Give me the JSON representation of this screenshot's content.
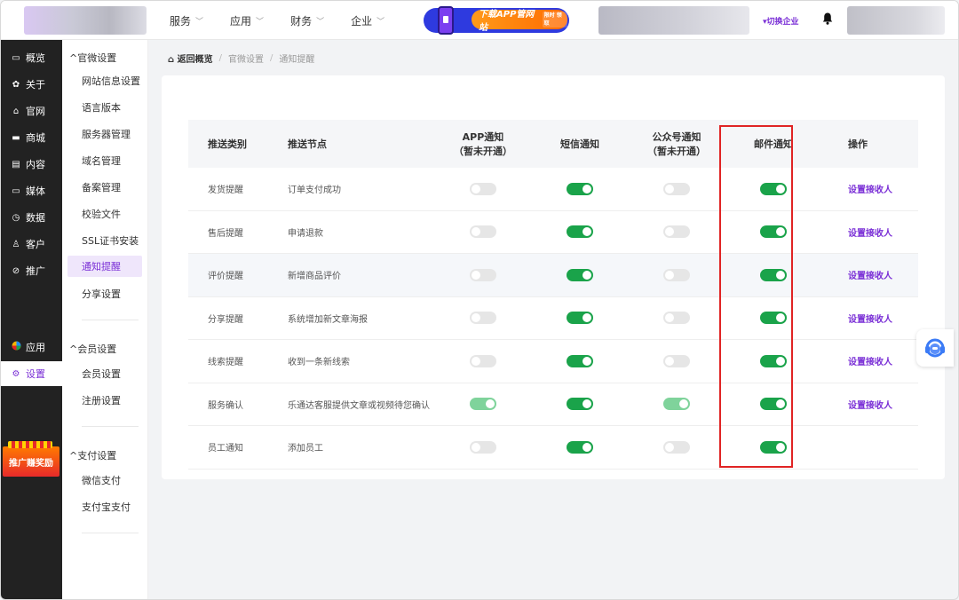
{
  "topnav": {
    "items": [
      {
        "label": "服务"
      },
      {
        "label": "应用"
      },
      {
        "label": "财务"
      },
      {
        "label": "企业"
      }
    ],
    "download_banner": "下载APP管网站",
    "banner_tag": "限时 领取",
    "switch_enterprise": "▾切换企业"
  },
  "sidebar_main": {
    "items": [
      {
        "label": "概览",
        "icon": "overview-icon"
      },
      {
        "label": "关于",
        "icon": "gear-icon"
      },
      {
        "label": "官网",
        "icon": "home-icon"
      },
      {
        "label": "商城",
        "icon": "shop-icon"
      },
      {
        "label": "内容",
        "icon": "document-icon"
      },
      {
        "label": "媒体",
        "icon": "media-icon"
      },
      {
        "label": "数据",
        "icon": "clock-icon"
      },
      {
        "label": "客户",
        "icon": "user-icon"
      },
      {
        "label": "推广",
        "icon": "link-icon"
      },
      {
        "label": "应用",
        "icon": "apps-icon"
      },
      {
        "label": "设置",
        "icon": "settings-icon"
      }
    ],
    "promo": "推广赚奖励"
  },
  "sidebar_sub": {
    "group1": "官微设置",
    "group1_items": [
      "网站信息设置",
      "语言版本",
      "服务器管理",
      "域名管理",
      "备案管理",
      "校验文件",
      "SSL证书安装",
      "通知提醒",
      "分享设置"
    ],
    "group2": "会员设置",
    "group2_items": [
      "会员设置",
      "注册设置"
    ],
    "group3": "支付设置",
    "group3_items": [
      "微信支付",
      "支付宝支付"
    ]
  },
  "breadcrumb": {
    "home": "返回概览",
    "level1": "官微设置",
    "level2": "通知提醒"
  },
  "table": {
    "headers": {
      "type": "推送类别",
      "node": "推送节点",
      "app": "APP通知",
      "app_note": "（暂未开通）",
      "sms": "短信通知",
      "wechat": "公众号通知",
      "wechat_note": "（暂未开通）",
      "email": "邮件通知",
      "action": "操作"
    },
    "rows": [
      {
        "type": "发货提醒",
        "node": "订单支付成功",
        "app": "off",
        "sms": "on",
        "wechat": "off",
        "email": "on",
        "action": "设置接收人"
      },
      {
        "type": "售后提醒",
        "node": "申请退款",
        "app": "off",
        "sms": "on",
        "wechat": "off",
        "email": "on",
        "action": "设置接收人"
      },
      {
        "type": "评价提醒",
        "node": "新增商品评价",
        "app": "off",
        "sms": "on",
        "wechat": "off",
        "email": "on",
        "action": "设置接收人"
      },
      {
        "type": "分享提醒",
        "node": "系统增加新文章海报",
        "app": "off",
        "sms": "on",
        "wechat": "off",
        "email": "on",
        "action": "设置接收人"
      },
      {
        "type": "线索提醒",
        "node": "收到一条新线索",
        "app": "off",
        "sms": "on",
        "wechat": "off",
        "email": "on",
        "action": "设置接收人"
      },
      {
        "type": "服务确认",
        "node": "乐通达客服提供文章或视频待您确认",
        "app": "dim",
        "sms": "on",
        "wechat": "dim",
        "email": "on",
        "action": "设置接收人"
      },
      {
        "type": "员工通知",
        "node": "添加员工",
        "app": "off",
        "sms": "on",
        "wechat": "off",
        "email": "on",
        "action": ""
      }
    ]
  },
  "colors": {
    "accent": "#7a2fd6",
    "toggle_on": "#1aa34a",
    "toggle_dim": "#7fd39b",
    "highlight_box": "#e02424"
  }
}
